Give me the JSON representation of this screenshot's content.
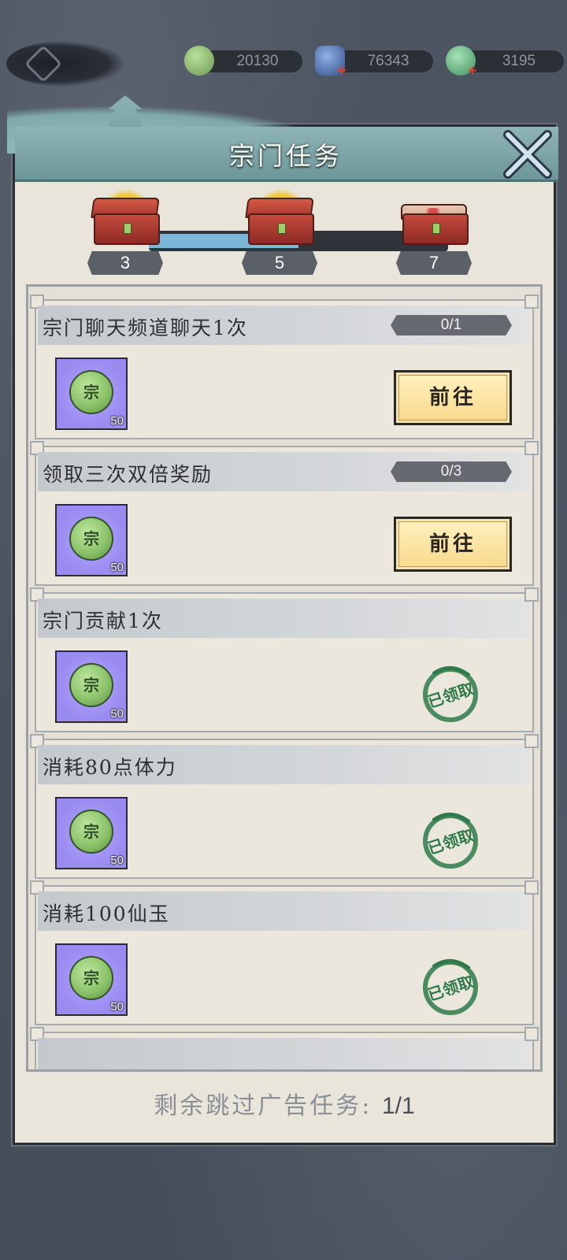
{
  "currencies": [
    {
      "icon": "sect-token-icon",
      "value": "20130",
      "color": "#7fb069",
      "has_plus": false
    },
    {
      "icon": "blue-stone-icon",
      "value": "76343",
      "color": "#3a5a9a",
      "has_plus": true
    },
    {
      "icon": "green-bag-icon",
      "value": "3195",
      "color": "#6dbf8a",
      "has_plus": true
    }
  ],
  "panel": {
    "title": "宗门任务"
  },
  "progress": {
    "value": 0.5,
    "milestones": [
      {
        "label": "3",
        "state": "opened"
      },
      {
        "label": "5",
        "state": "opened"
      },
      {
        "label": "7",
        "state": "closed"
      }
    ]
  },
  "tasks": [
    {
      "name": "宗门聊天频道聊天1次",
      "count": "0/1",
      "reward_glyph": "宗",
      "reward_qty": "50",
      "status": "go",
      "button_label": "前往"
    },
    {
      "name": "领取三次双倍奖励",
      "count": "0/3",
      "reward_glyph": "宗",
      "reward_qty": "50",
      "status": "go",
      "button_label": "前往"
    },
    {
      "name": "宗门贡献1次",
      "count": "",
      "reward_glyph": "宗",
      "reward_qty": "50",
      "status": "claimed",
      "stamp_label": "已领取"
    },
    {
      "name": "消耗80点体力",
      "count": "",
      "reward_glyph": "宗",
      "reward_qty": "50",
      "status": "claimed",
      "stamp_label": "已领取"
    },
    {
      "name": "消耗100仙玉",
      "count": "",
      "reward_glyph": "宗",
      "reward_qty": "50",
      "status": "claimed",
      "stamp_label": "已领取"
    }
  ],
  "footer": {
    "label": "剩余跳过广告任务:",
    "value": "1/1"
  },
  "colors": {
    "progress_fill": "#7ab7d8",
    "button_fill": "#f7d98a",
    "stamp_green": "#2f7a4a",
    "reward_bg": "#9a8bf0"
  }
}
